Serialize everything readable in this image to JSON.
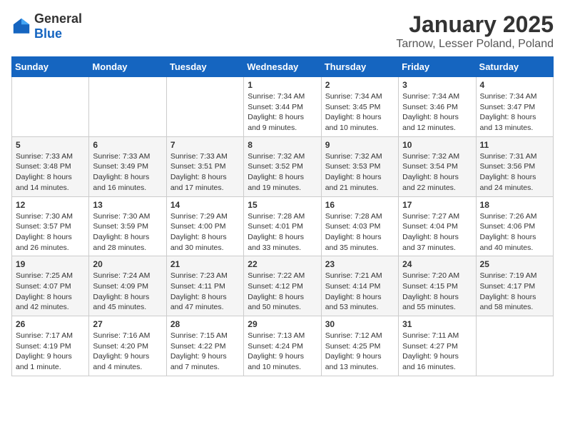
{
  "header": {
    "logo_general": "General",
    "logo_blue": "Blue",
    "month": "January 2025",
    "location": "Tarnow, Lesser Poland, Poland"
  },
  "weekdays": [
    "Sunday",
    "Monday",
    "Tuesday",
    "Wednesday",
    "Thursday",
    "Friday",
    "Saturday"
  ],
  "rows": [
    [
      {
        "day": "",
        "info": ""
      },
      {
        "day": "",
        "info": ""
      },
      {
        "day": "",
        "info": ""
      },
      {
        "day": "1",
        "info": "Sunrise: 7:34 AM\nSunset: 3:44 PM\nDaylight: 8 hours\nand 9 minutes."
      },
      {
        "day": "2",
        "info": "Sunrise: 7:34 AM\nSunset: 3:45 PM\nDaylight: 8 hours\nand 10 minutes."
      },
      {
        "day": "3",
        "info": "Sunrise: 7:34 AM\nSunset: 3:46 PM\nDaylight: 8 hours\nand 12 minutes."
      },
      {
        "day": "4",
        "info": "Sunrise: 7:34 AM\nSunset: 3:47 PM\nDaylight: 8 hours\nand 13 minutes."
      }
    ],
    [
      {
        "day": "5",
        "info": "Sunrise: 7:33 AM\nSunset: 3:48 PM\nDaylight: 8 hours\nand 14 minutes."
      },
      {
        "day": "6",
        "info": "Sunrise: 7:33 AM\nSunset: 3:49 PM\nDaylight: 8 hours\nand 16 minutes."
      },
      {
        "day": "7",
        "info": "Sunrise: 7:33 AM\nSunset: 3:51 PM\nDaylight: 8 hours\nand 17 minutes."
      },
      {
        "day": "8",
        "info": "Sunrise: 7:32 AM\nSunset: 3:52 PM\nDaylight: 8 hours\nand 19 minutes."
      },
      {
        "day": "9",
        "info": "Sunrise: 7:32 AM\nSunset: 3:53 PM\nDaylight: 8 hours\nand 21 minutes."
      },
      {
        "day": "10",
        "info": "Sunrise: 7:32 AM\nSunset: 3:54 PM\nDaylight: 8 hours\nand 22 minutes."
      },
      {
        "day": "11",
        "info": "Sunrise: 7:31 AM\nSunset: 3:56 PM\nDaylight: 8 hours\nand 24 minutes."
      }
    ],
    [
      {
        "day": "12",
        "info": "Sunrise: 7:30 AM\nSunset: 3:57 PM\nDaylight: 8 hours\nand 26 minutes."
      },
      {
        "day": "13",
        "info": "Sunrise: 7:30 AM\nSunset: 3:59 PM\nDaylight: 8 hours\nand 28 minutes."
      },
      {
        "day": "14",
        "info": "Sunrise: 7:29 AM\nSunset: 4:00 PM\nDaylight: 8 hours\nand 30 minutes."
      },
      {
        "day": "15",
        "info": "Sunrise: 7:28 AM\nSunset: 4:01 PM\nDaylight: 8 hours\nand 33 minutes."
      },
      {
        "day": "16",
        "info": "Sunrise: 7:28 AM\nSunset: 4:03 PM\nDaylight: 8 hours\nand 35 minutes."
      },
      {
        "day": "17",
        "info": "Sunrise: 7:27 AM\nSunset: 4:04 PM\nDaylight: 8 hours\nand 37 minutes."
      },
      {
        "day": "18",
        "info": "Sunrise: 7:26 AM\nSunset: 4:06 PM\nDaylight: 8 hours\nand 40 minutes."
      }
    ],
    [
      {
        "day": "19",
        "info": "Sunrise: 7:25 AM\nSunset: 4:07 PM\nDaylight: 8 hours\nand 42 minutes."
      },
      {
        "day": "20",
        "info": "Sunrise: 7:24 AM\nSunset: 4:09 PM\nDaylight: 8 hours\nand 45 minutes."
      },
      {
        "day": "21",
        "info": "Sunrise: 7:23 AM\nSunset: 4:11 PM\nDaylight: 8 hours\nand 47 minutes."
      },
      {
        "day": "22",
        "info": "Sunrise: 7:22 AM\nSunset: 4:12 PM\nDaylight: 8 hours\nand 50 minutes."
      },
      {
        "day": "23",
        "info": "Sunrise: 7:21 AM\nSunset: 4:14 PM\nDaylight: 8 hours\nand 53 minutes."
      },
      {
        "day": "24",
        "info": "Sunrise: 7:20 AM\nSunset: 4:15 PM\nDaylight: 8 hours\nand 55 minutes."
      },
      {
        "day": "25",
        "info": "Sunrise: 7:19 AM\nSunset: 4:17 PM\nDaylight: 8 hours\nand 58 minutes."
      }
    ],
    [
      {
        "day": "26",
        "info": "Sunrise: 7:17 AM\nSunset: 4:19 PM\nDaylight: 9 hours\nand 1 minute."
      },
      {
        "day": "27",
        "info": "Sunrise: 7:16 AM\nSunset: 4:20 PM\nDaylight: 9 hours\nand 4 minutes."
      },
      {
        "day": "28",
        "info": "Sunrise: 7:15 AM\nSunset: 4:22 PM\nDaylight: 9 hours\nand 7 minutes."
      },
      {
        "day": "29",
        "info": "Sunrise: 7:13 AM\nSunset: 4:24 PM\nDaylight: 9 hours\nand 10 minutes."
      },
      {
        "day": "30",
        "info": "Sunrise: 7:12 AM\nSunset: 4:25 PM\nDaylight: 9 hours\nand 13 minutes."
      },
      {
        "day": "31",
        "info": "Sunrise: 7:11 AM\nSunset: 4:27 PM\nDaylight: 9 hours\nand 16 minutes."
      },
      {
        "day": "",
        "info": ""
      }
    ]
  ]
}
